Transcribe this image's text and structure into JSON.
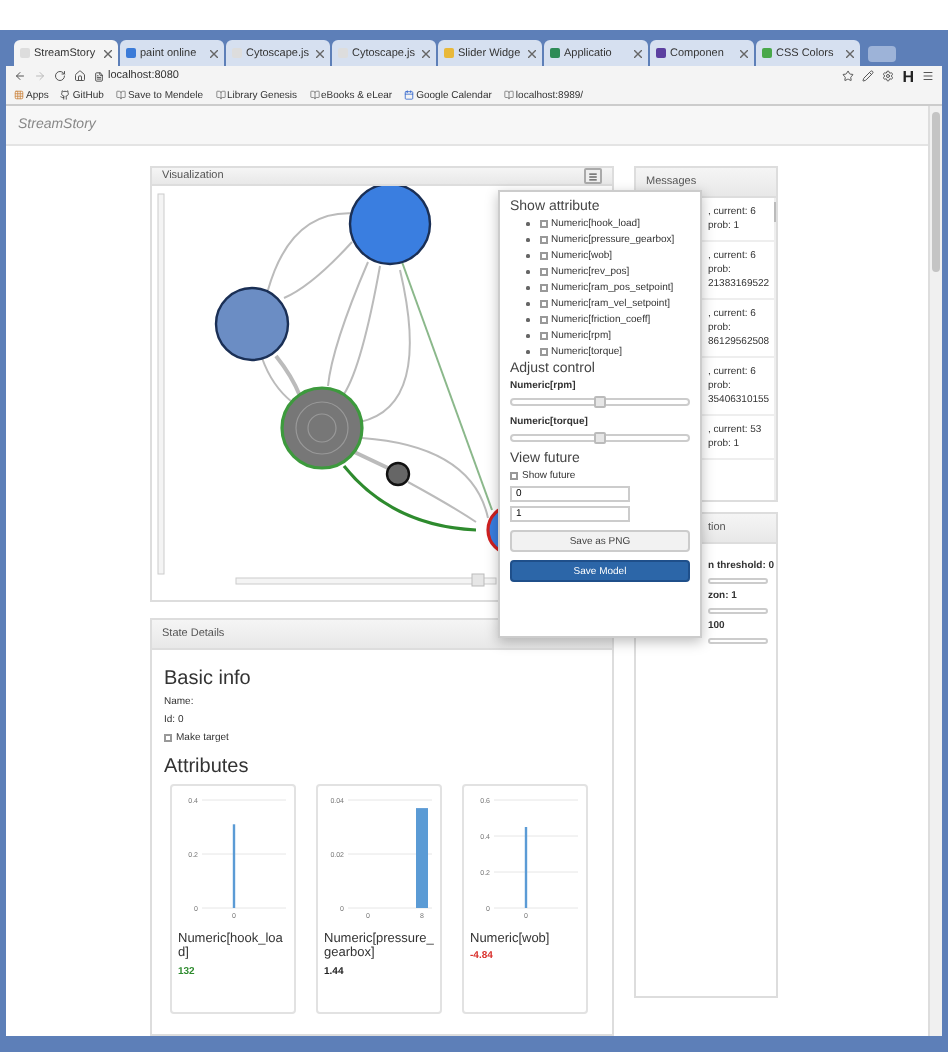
{
  "browser": {
    "tabs": [
      {
        "label": "StreamStory",
        "selected": true,
        "color": "#dddddd"
      },
      {
        "label": "paint online",
        "selected": false,
        "color": "#3b7bd8"
      },
      {
        "label": "Cytoscape.js",
        "selected": false,
        "color": "#dddddd"
      },
      {
        "label": "Cytoscape.js",
        "selected": false,
        "color": "#dddddd"
      },
      {
        "label": "Slider Widge",
        "selected": false,
        "color": "#e8b83a"
      },
      {
        "label": "Applicatio",
        "selected": false,
        "color": "#2e8b57"
      },
      {
        "label": "Componen",
        "selected": false,
        "color": "#5b3fa0"
      },
      {
        "label": "CSS Colors",
        "selected": false,
        "color": "#49a84a"
      }
    ],
    "address": "localhost:8080",
    "extension_label": "H",
    "bookmarks": [
      "Apps",
      "GitHub",
      "Save to Mendele",
      "Library Genesis",
      "eBooks & eLear",
      "Google Calendar",
      "localhost:8989/"
    ]
  },
  "page": {
    "brand": "StreamStory"
  },
  "visualization": {
    "title": "Visualization"
  },
  "popup": {
    "show_attribute_title": "Show attribute",
    "attributes": [
      {
        "label": "Numeric[hook_load]",
        "checked": false
      },
      {
        "label": "Numeric[pressure_gearbox]",
        "checked": false
      },
      {
        "label": "Numeric[wob]",
        "checked": false
      },
      {
        "label": "Numeric[rev_pos]",
        "checked": false
      },
      {
        "label": "Numeric[ram_pos_setpoint]",
        "checked": false
      },
      {
        "label": "Numeric[ram_vel_setpoint]",
        "checked": false
      },
      {
        "label": "Numeric[friction_coeff]",
        "checked": false
      },
      {
        "label": "Numeric[rpm]",
        "checked": false
      },
      {
        "label": "Numeric[torque]",
        "checked": false
      }
    ],
    "adjust_control_title": "Adjust control",
    "controls": [
      {
        "label": "Numeric[rpm]",
        "level": 0.5
      },
      {
        "label": "Numeric[torque]",
        "level": 0.5
      }
    ],
    "view_future_title": "View future",
    "show_future": {
      "label": "Show future",
      "checked": false
    },
    "inputs": [
      "0",
      "1"
    ],
    "buttons": [
      {
        "label": "Save as PNG",
        "kind": "default"
      },
      {
        "label": "Save Model",
        "kind": "primary"
      }
    ]
  },
  "messages": {
    "title": "Messages",
    "items": [
      {
        "lines": [
          ", current: 6",
          "prob: 1"
        ]
      },
      {
        "lines": [
          ", current: 6",
          "prob:",
          "21383169522"
        ]
      },
      {
        "lines": [
          ", current: 6",
          "prob:",
          "86129562508"
        ]
      },
      {
        "lines": [
          ", current: 6",
          "prob:",
          "35406310155"
        ]
      },
      {
        "lines": [
          ", current: 53",
          "prob: 1"
        ]
      }
    ]
  },
  "panel_2": {
    "title": "tion",
    "fields": [
      "n threshold: 0",
      "zon: 1",
      "100"
    ]
  },
  "state_details": {
    "title": "State Details",
    "basic_info_title": "Basic info",
    "name": "Name:",
    "id": "Id: 0",
    "make_target": {
      "label": "Make target",
      "checked": false
    },
    "attributes_title": "Attributes",
    "attributes": [
      {
        "name": "Numeric[hook_load]",
        "value": "132",
        "color": "#2e8b2e",
        "chart_data": {
          "type": "bar",
          "categories": [
            "0"
          ],
          "values": [
            0.31
          ],
          "ylim": [
            0,
            0.4
          ],
          "yticks": [
            0,
            0.2,
            0.4
          ]
        }
      },
      {
        "name": "Numeric[pressure_gearbox]",
        "value": "1.44",
        "color": "#222222",
        "chart_data": {
          "type": "bar",
          "categories": [
            "0",
            "8"
          ],
          "values": [
            0,
            0.037
          ],
          "ylim": [
            0,
            0.04
          ],
          "yticks": [
            0,
            0.02,
            0.04
          ]
        }
      },
      {
        "name": "Numeric[wob]",
        "value": "-4.84",
        "color": "#d9302c",
        "chart_data": {
          "type": "bar",
          "categories": [
            "0"
          ],
          "values": [
            0.45
          ],
          "ylim": [
            0,
            0.6
          ],
          "yticks": [
            0,
            0.2,
            0.4,
            0.6
          ]
        }
      }
    ]
  }
}
